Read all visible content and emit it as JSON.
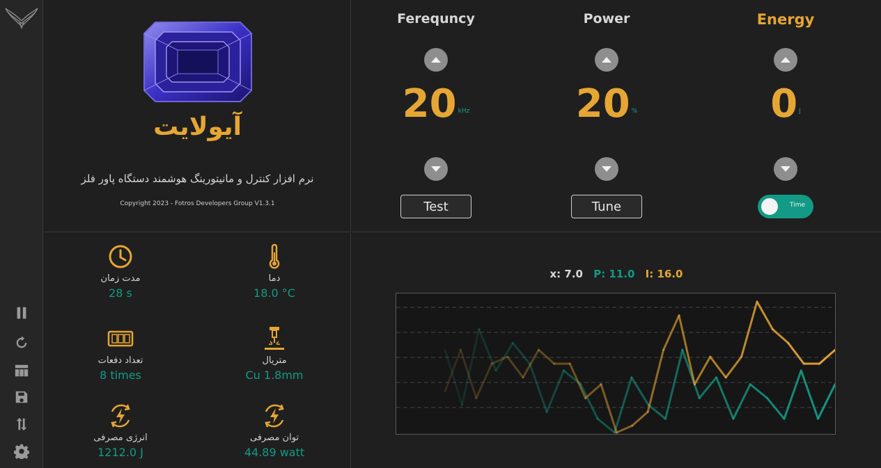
{
  "sidebar": {
    "logo_icon": "winged-logo-icon",
    "buttons": [
      "pause-icon",
      "refresh-icon",
      "table-icon",
      "save-icon",
      "sort-icon",
      "settings-icon"
    ]
  },
  "info": {
    "title": "آیولایت",
    "subtitle": "نرم افزار کنترل و مانیتورینگ هوشمند دستگاه پاور فلز",
    "copyright": "Copyright 2023 - Fotros Developers Group  V1.3.1",
    "image_icon": "gemstone-image"
  },
  "controls": {
    "frequency": {
      "title": "Ferequncy",
      "value": "20",
      "unit": "kHz",
      "button": "Test"
    },
    "power": {
      "title": "Power",
      "value": "20",
      "unit": "%",
      "button": "Tune"
    },
    "energy": {
      "title": "Energy",
      "value": "0",
      "unit": "J",
      "toggle_label": "Time",
      "toggle_on": true
    }
  },
  "stats": [
    {
      "label": "مدت زمان",
      "value": "28 s",
      "icon": "clock-icon"
    },
    {
      "label": "دما",
      "value": "18.0 °C",
      "icon": "thermometer-icon"
    },
    {
      "label": "تعداد دفعات",
      "value": "8 times",
      "icon": "counter-icon"
    },
    {
      "label": "متریال",
      "value": "Cu 1.8mm",
      "icon": "welding-tip-icon"
    },
    {
      "label": "انرژی مصرفی",
      "value": "1212.0 J",
      "icon": "energy-cycle-icon"
    },
    {
      "label": "توان مصرفی",
      "value": "44.89 watt",
      "icon": "power-cycle-icon"
    }
  ],
  "readout": {
    "x": "x: 7.0",
    "p": "P: 11.0",
    "i": "I: 16.0"
  },
  "colors": {
    "accent": "#e6a634",
    "teal": "#139a86",
    "background": "#1f1f1f"
  },
  "chart_data": {
    "type": "line",
    "grid": true,
    "ylim": [
      0,
      20
    ],
    "series": [
      {
        "color": "#139a86",
        "values": [
          12,
          4,
          15,
          9,
          13,
          10,
          3,
          9,
          7,
          2,
          0,
          8,
          4,
          2,
          12,
          5,
          8,
          2,
          7,
          5,
          2,
          9,
          2,
          7
        ]
      },
      {
        "color": "#e6a634",
        "values": [
          6,
          12,
          5,
          10,
          11,
          8,
          12,
          10,
          10,
          5,
          7,
          0,
          1,
          3,
          12,
          17,
          7,
          11,
          8,
          11,
          19,
          15,
          13,
          10,
          10,
          12
        ]
      }
    ]
  }
}
